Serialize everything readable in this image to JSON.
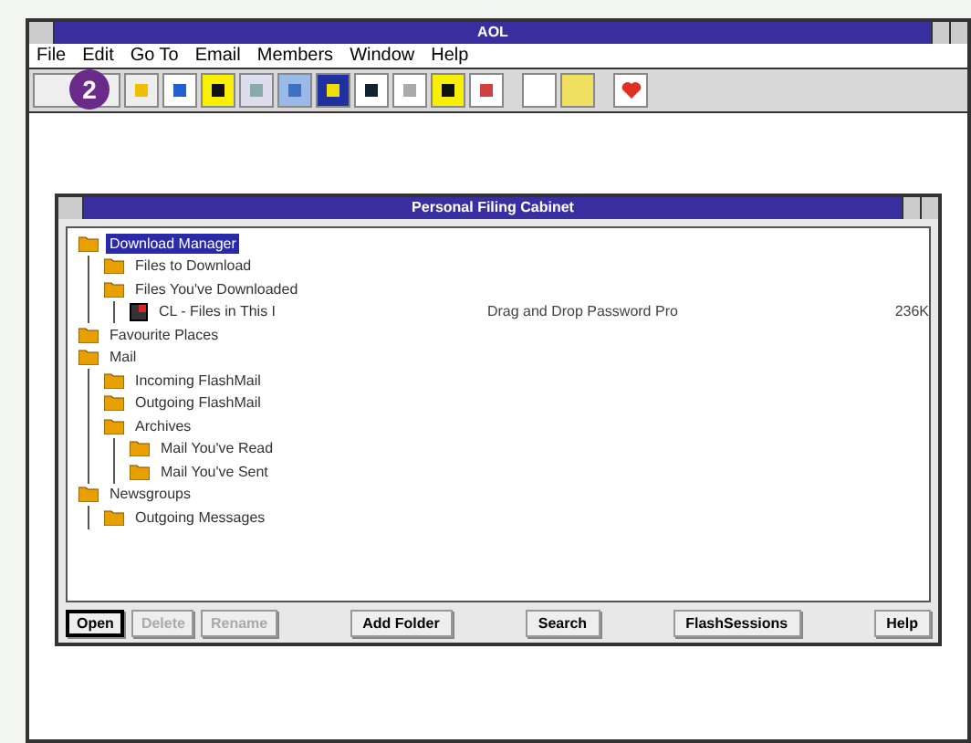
{
  "window": {
    "title": "AOL"
  },
  "menu": [
    {
      "label": "File"
    },
    {
      "label": "Edit"
    },
    {
      "label": "Go To"
    },
    {
      "label": "Email"
    },
    {
      "label": "Members"
    },
    {
      "label": "Window"
    },
    {
      "label": "Help"
    }
  ],
  "step_badge": "2",
  "dialog": {
    "title": "Personal Filing Cabinet",
    "tree": [
      {
        "label": "Download Manager",
        "kind": "folder",
        "selected": true,
        "children": [
          {
            "label": "Files to Download",
            "kind": "folder",
            "selected": false
          },
          {
            "label": "Files You've Downloaded",
            "kind": "folder",
            "selected": false,
            "children": [
              {
                "label": "CL - Files in This I",
                "kind": "file",
                "selected": false,
                "column_2": "Drag and Drop Password Pro",
                "column_3": "236K"
              }
            ]
          }
        ]
      },
      {
        "label": "Favourite Places",
        "kind": "folder",
        "selected": false
      },
      {
        "label": "Mail",
        "kind": "folder",
        "selected": false,
        "children": [
          {
            "label": "Incoming FlashMail",
            "kind": "folder",
            "selected": false
          },
          {
            "label": "Outgoing FlashMail",
            "kind": "folder",
            "selected": false
          },
          {
            "label": "Archives",
            "kind": "folder",
            "selected": false,
            "children": [
              {
                "label": "Mail You've Read",
                "kind": "folder",
                "selected": false
              },
              {
                "label": "Mail You've Sent",
                "kind": "folder",
                "selected": false
              }
            ]
          }
        ]
      },
      {
        "label": "Newsgroups",
        "kind": "folder",
        "selected": false,
        "children": [
          {
            "label": "Outgoing Messages",
            "kind": "folder",
            "selected": false
          }
        ]
      }
    ],
    "buttons": [
      {
        "label": "Open",
        "disabled": false,
        "default": true
      },
      {
        "label": "Delete",
        "disabled": true,
        "default": false
      },
      {
        "label": "Rename",
        "disabled": true,
        "default": false
      },
      {
        "label": "Add Folder",
        "disabled": false,
        "default": false
      },
      {
        "label": "Search",
        "disabled": false,
        "default": false
      },
      {
        "label": "FlashSessions",
        "disabled": false,
        "default": false
      },
      {
        "label": "Help",
        "disabled": false,
        "default": false
      }
    ]
  }
}
